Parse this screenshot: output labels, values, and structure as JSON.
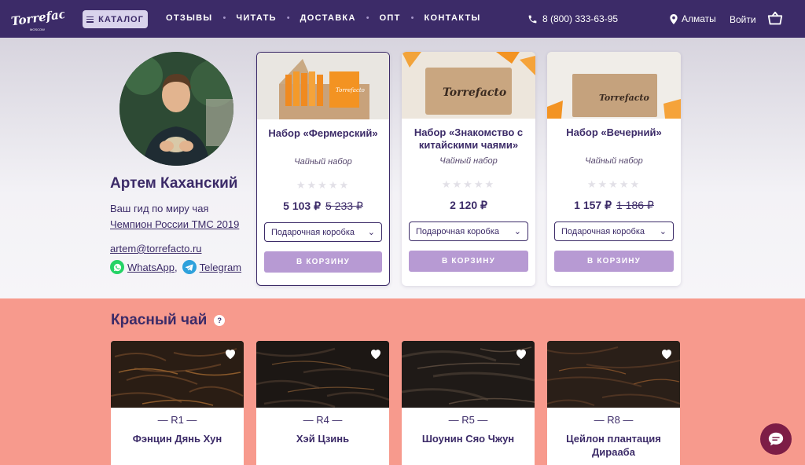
{
  "header": {
    "logo_text": "Torrefacto",
    "catalog_label": "КАТАЛОГ",
    "nav": [
      "ОТЗЫВЫ",
      "ЧИТАТЬ",
      "ДОСТАВКА",
      "ОПТ",
      "КОНТАКТЫ"
    ],
    "phone": "8 (800) 333-63-95",
    "city": "Алматы",
    "login": "Войти"
  },
  "guide": {
    "name": "Артем Каханский",
    "role": "Ваш гид по миру чая",
    "award": "Чемпион России ТМС 2019",
    "email": "artem@torrefacto.ru",
    "whatsapp": "WhatsApp",
    "separator": ",",
    "telegram": "Telegram"
  },
  "sets": [
    {
      "title": "Набор «Фермерский»",
      "subtitle": "Чайный набор",
      "rating": 0,
      "price": "5 103 ₽",
      "old_price": "5 233 ₽",
      "option": "Подарочная коробка",
      "button": "В КОРЗИНУ"
    },
    {
      "title": "Набор «Знакомство с китайскими чаями»",
      "subtitle": "Чайный набор",
      "rating": 0,
      "price": "2 120 ₽",
      "old_price": "",
      "option": "Подарочная коробка",
      "button": "В КОРЗИНУ"
    },
    {
      "title": "Набор «Вечерний»",
      "subtitle": "Чайный набор",
      "rating": 0,
      "price": "1 157 ₽",
      "old_price": "1 186 ₽",
      "option": "Подарочная коробка",
      "button": "В КОРЗИНУ"
    }
  ],
  "red_tea": {
    "title": "Красный чай",
    "help": "?",
    "items": [
      {
        "code": "— R1 —",
        "name": "Фэнцин Дянь Хун"
      },
      {
        "code": "— R4 —",
        "name": "Хэй Цзинь"
      },
      {
        "code": "— R5 —",
        "name": "Шоунин Сяо Чжун"
      },
      {
        "code": "— R8 —",
        "name": "Цейлон плантация Дирааба"
      }
    ]
  },
  "colors": {
    "header_bg": "#3c2b68",
    "accent_button": "#b79ad3",
    "section_bg": "#f79a8d",
    "chat_bg": "#7d1d46"
  }
}
